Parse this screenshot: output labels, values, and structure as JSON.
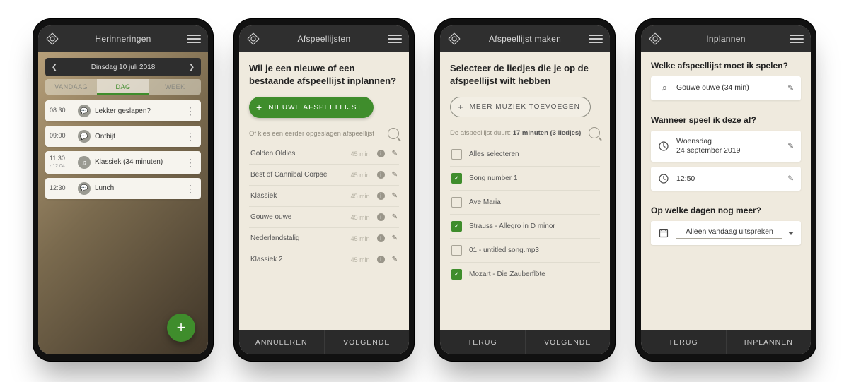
{
  "phone1": {
    "title": "Herinneringen",
    "date": "Dinsdag 10 juli 2018",
    "tabs": [
      "VANDAAG",
      "DAG",
      "WEEK"
    ],
    "active_tab": 1,
    "items": [
      {
        "time": "08:30",
        "time2": "",
        "icon": "chat",
        "label": "Lekker geslapen?"
      },
      {
        "time": "09:00",
        "time2": "",
        "icon": "chat",
        "label": "Ontbijt"
      },
      {
        "time": "11:30",
        "time2": "- 12:04",
        "icon": "music",
        "label": "Klassiek (34 minuten)"
      },
      {
        "time": "12:30",
        "time2": "",
        "icon": "chat",
        "label": "Lunch"
      }
    ]
  },
  "phone2": {
    "title": "Afspeellijsten",
    "question": "Wil je een nieuwe of een bestaande afspeellijst inplannen?",
    "new_btn": "NIEUWE AFSPEELLIJST",
    "sub": "Of kies een eerder opgeslagen afspeellijst",
    "items": [
      {
        "name": "Golden Oldies",
        "dur": "45 min"
      },
      {
        "name": "Best of Cannibal Corpse",
        "dur": "45 min"
      },
      {
        "name": "Klassiek",
        "dur": "45 min"
      },
      {
        "name": "Gouwe ouwe",
        "dur": "45 min"
      },
      {
        "name": "Nederlandstalig",
        "dur": "45 min"
      },
      {
        "name": "Klassiek 2",
        "dur": "45 min"
      }
    ],
    "footer": [
      "ANNULEREN",
      "VOLGENDE"
    ]
  },
  "phone3": {
    "title": "Afspeellijst maken",
    "question": "Selecteer de liedjes die je op de afspeellijst wilt hebben",
    "more_btn": "MEER MUZIEK TOEVOEGEN",
    "sub_a": "De afspeellijst duurt:",
    "sub_b": "17 minuten (3 liedjes)",
    "items": [
      {
        "on": false,
        "name": "Alles selecteren"
      },
      {
        "on": true,
        "name": "Song number 1"
      },
      {
        "on": false,
        "name": "Ave Maria"
      },
      {
        "on": true,
        "name": "Strauss - Allegro in D minor"
      },
      {
        "on": false,
        "name": "01 - untitled song.mp3"
      },
      {
        "on": true,
        "name": "Mozart - Die Zauberflöte"
      }
    ],
    "footer": [
      "TERUG",
      "VOLGENDE"
    ]
  },
  "phone4": {
    "title": "Inplannen",
    "q1": "Welke afspeellijst moet ik spelen?",
    "playlist": "Gouwe ouwe (34 min)",
    "q2": "Wanneer speel ik deze af?",
    "date_a": "Woensdag",
    "date_b": "24 september 2019",
    "time": "12:50",
    "q3": "Op welke dagen nog meer?",
    "sel": "Alleen vandaag uitspreken",
    "footer": [
      "TERUG",
      "INPLANNEN"
    ]
  }
}
